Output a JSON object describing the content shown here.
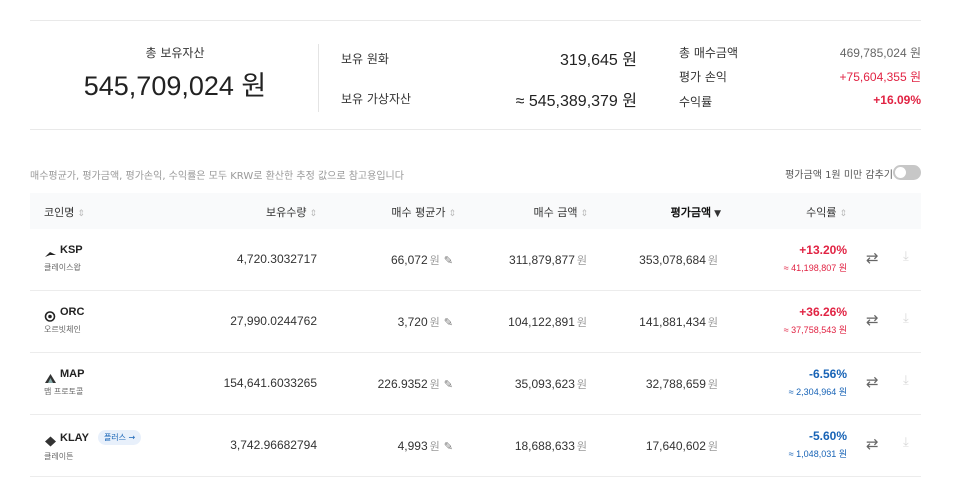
{
  "summary": {
    "total_label": "총 보유자산",
    "total_value": "545,709,024 원",
    "krw_label": "보유 원화",
    "krw_value": "319,645 원",
    "crypto_label": "보유 가상자산",
    "crypto_value": "≈ 545,389,379 원",
    "buy_total_label": "총 매수금액",
    "buy_total_value": "469,785,024 원",
    "pnl_label": "평가 손익",
    "pnl_value": "+75,604,355 원",
    "return_label": "수익률",
    "return_value": "+16.09%"
  },
  "notice": "매수평균가, 평가금액, 평가손익, 수익률은 모두 KRW로 환산한 추정 값으로 참고용입니다",
  "hide_small_label": "평가금액 1원 미만 감추기",
  "table": {
    "headers": {
      "coin": "코인명",
      "qty": "보유수량",
      "avg": "매수 평균가",
      "buy": "매수 금액",
      "eval": "평가금액",
      "ret": "수익률"
    },
    "unit": "원",
    "rows": [
      {
        "symbol": "KSP",
        "name": "클레이스왑",
        "qty": "4,720.3032717",
        "avg": "66,072",
        "buy": "311,879,877",
        "eval": "353,078,684",
        "pct": "+13.20%",
        "amt": "≈ 41,198,807 원",
        "dir": "up",
        "icon": "ksp-icon"
      },
      {
        "symbol": "ORC",
        "name": "오르빗체인",
        "qty": "27,990.0244762",
        "avg": "3,720",
        "buy": "104,122,891",
        "eval": "141,881,434",
        "pct": "+36.26%",
        "amt": "≈ 37,758,543 원",
        "dir": "up",
        "icon": "orc-icon"
      },
      {
        "symbol": "MAP",
        "name": "맵 프로토콜",
        "qty": "154,641.6033265",
        "avg": "226.9352",
        "buy": "35,093,623",
        "eval": "32,788,659",
        "pct": "-6.56%",
        "amt": "≈ 2,304,964 원",
        "dir": "down",
        "icon": "map-icon"
      },
      {
        "symbol": "KLAY",
        "name": "클레이튼",
        "badge": "플러스 →",
        "qty": "3,742.96682794",
        "avg": "4,993",
        "buy": "18,688,633",
        "eval": "17,640,602",
        "pct": "-5.60%",
        "amt": "≈ 1,048,031 원",
        "dir": "down",
        "icon": "klay-icon"
      }
    ]
  },
  "colors": {
    "up": "#e12343",
    "down": "#1763b6",
    "header_bg": "#f9fafb"
  }
}
